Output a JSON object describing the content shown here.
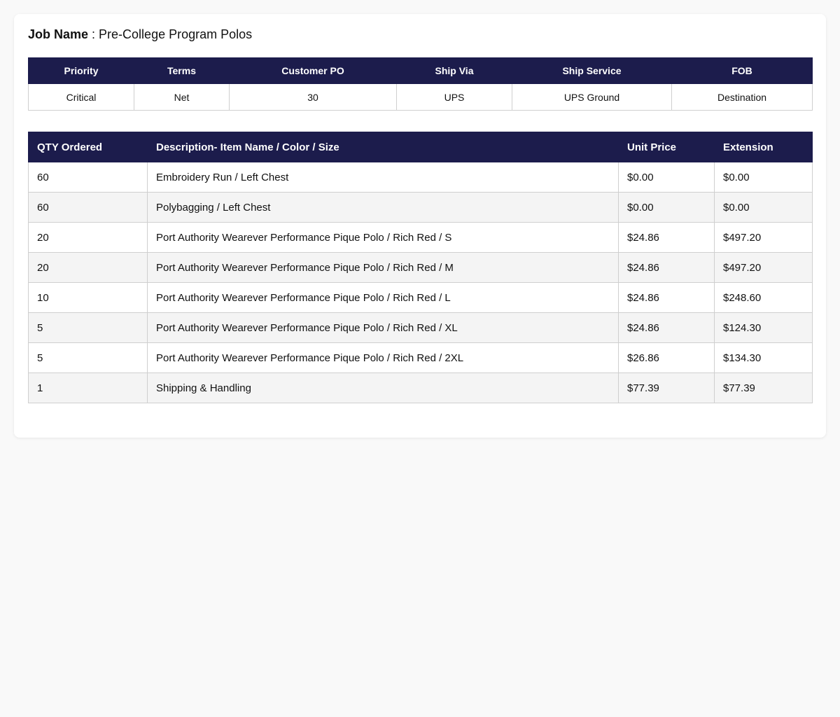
{
  "job": {
    "label": "Job Name",
    "separator": " : ",
    "value": "Pre-College Program Polos"
  },
  "meta": {
    "headers": [
      "Priority",
      "Terms",
      "Customer PO",
      "Ship Via",
      "Ship Service",
      "FOB"
    ],
    "values": [
      "Critical",
      "Net",
      "30",
      "UPS",
      "UPS Ground",
      "Destination"
    ]
  },
  "items": {
    "headers": [
      "QTY Ordered",
      "Description- Item Name / Color / Size",
      "Unit Price",
      "Extension"
    ],
    "rows": [
      {
        "qty": "60",
        "description": "Embroidery Run / Left Chest",
        "unit_price": "$0.00",
        "extension": "$0.00"
      },
      {
        "qty": "60",
        "description": "Polybagging / Left Chest",
        "unit_price": "$0.00",
        "extension": "$0.00"
      },
      {
        "qty": "20",
        "description": "Port Authority Wearever Performance Pique Polo / Rich Red / S",
        "unit_price": "$24.86",
        "extension": "$497.20"
      },
      {
        "qty": "20",
        "description": "Port Authority Wearever Performance Pique Polo / Rich Red / M",
        "unit_price": "$24.86",
        "extension": "$497.20"
      },
      {
        "qty": "10",
        "description": "Port Authority Wearever Performance Pique Polo / Rich Red / L",
        "unit_price": "$24.86",
        "extension": "$248.60"
      },
      {
        "qty": "5",
        "description": "Port Authority Wearever Performance Pique Polo / Rich Red / XL",
        "unit_price": "$24.86",
        "extension": "$124.30"
      },
      {
        "qty": "5",
        "description": "Port Authority Wearever Performance Pique Polo / Rich Red / 2XL",
        "unit_price": "$26.86",
        "extension": "$134.30"
      },
      {
        "qty": "1",
        "description": "Shipping & Handling",
        "unit_price": "$77.39",
        "extension": "$77.39"
      }
    ]
  },
  "colors": {
    "header_bg": "#1c1c4c",
    "row_alt_bg": "#f4f4f4",
    "page_bg": "#f9f9f9"
  }
}
